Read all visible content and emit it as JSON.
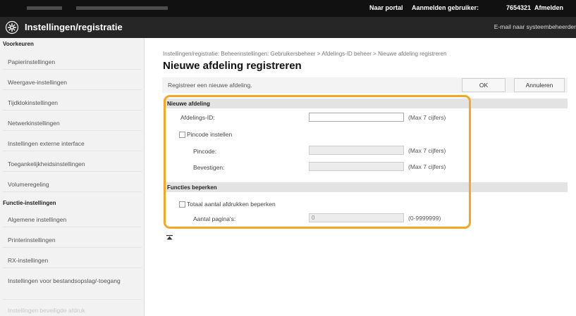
{
  "topbar": {
    "portal_link": "Naar portal",
    "user_label": "Aanmelden gebruiker:",
    "user_id": "7654321",
    "logout": "Afmelden"
  },
  "header": {
    "title": "Instellingen/registratie",
    "mail_link": "E-mail naar systeembeheerder",
    "icon": "gear-icon"
  },
  "sidebar": {
    "section1": "Voorkeuren",
    "items1": [
      "Papierinstellingen",
      "Weergave-instellingen",
      "Tijdklokinstellingen",
      "Netwerkinstellingen",
      "Instellingen externe interface",
      "Toegankelijkheidsinstellingen",
      "Volumeregeling"
    ],
    "section2": "Functie-instellingen",
    "items2": [
      "Algemene instellingen",
      "Printerinstellingen",
      "RX-instellingen",
      "Instellingen voor bestandsopslag/-toegang",
      "Instellingen beveiligde afdruk"
    ]
  },
  "main": {
    "breadcrumb": "Instellingen/registratie: Beheerinstellingen: Gebruikersbeheer > Afdelings-ID beheer > Nieuwe afdeling registreren",
    "title": "Nieuwe afdeling registreren",
    "prompt": "Registreer een nieuwe afdeling.",
    "ok_label": "OK",
    "cancel_label": "Annuleren",
    "section_new": "Nieuwe afdeling",
    "dept_id_label": "Afdelings-ID:",
    "dept_id_value": "",
    "dept_id_hint": "(Max 7 cijfers)",
    "pin_checkbox_label": "Pincode instellen",
    "pin_checked": false,
    "pin_label": "Pincode:",
    "pin_hint": "(Max 7 cijfers)",
    "confirm_label": "Bevestigen:",
    "confirm_hint": "(Max 7 cijfers)",
    "section_limits": "Functies beperken",
    "limit_checkbox_label": "Totaal aantal afdrukken beperken",
    "limit_checked": false,
    "pages_label": "Aantal pagina's:",
    "pages_value": "0",
    "pages_hint": "(0-9999999)"
  },
  "colors": {
    "highlight": "#f5a623",
    "topbar": "#111111",
    "header": "#262626"
  }
}
